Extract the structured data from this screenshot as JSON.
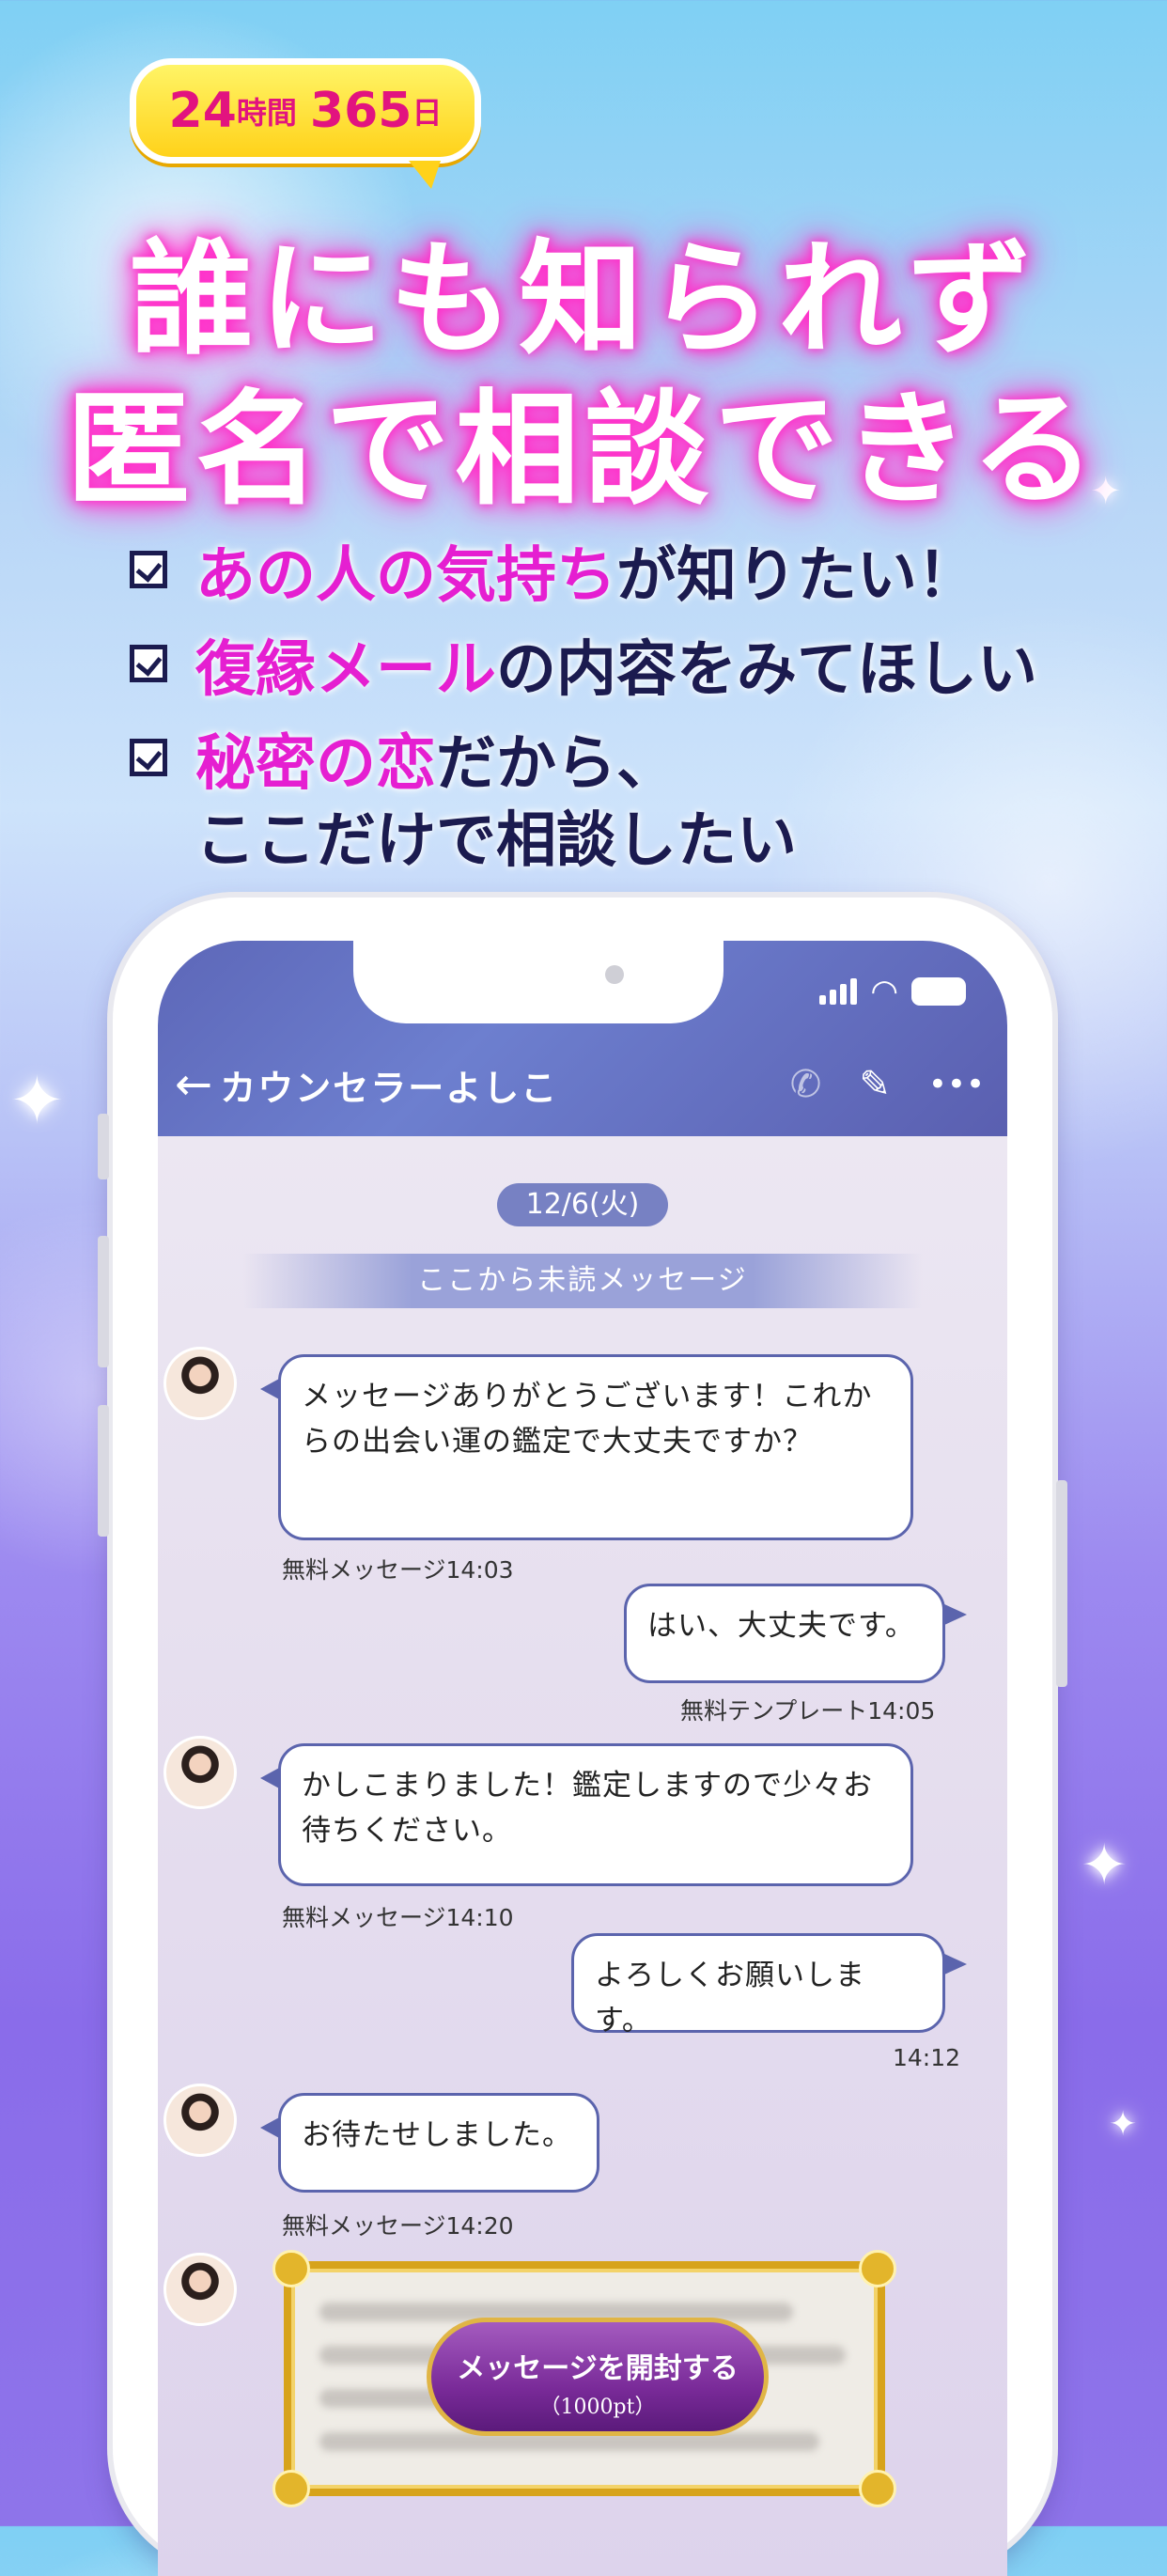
{
  "badge": {
    "hours": "24",
    "hours_unit": "時間",
    "days": "365",
    "days_unit": "日"
  },
  "headline": {
    "line1": "誰にも知られず",
    "line2": "匿名で相談できる"
  },
  "checklist": [
    {
      "highlight": "あの人の気持ち",
      "rest": "が知りたい！"
    },
    {
      "highlight": "復縁メール",
      "rest": "の内容をみてほしい"
    },
    {
      "highlight": "秘密の恋",
      "rest": "だから、",
      "line2": "ここだけで相談したい"
    }
  ],
  "chat": {
    "title": "カウンセラーよしこ",
    "date": "12/6(火)",
    "unread_label": "ここから未読メッセージ",
    "messages": [
      {
        "side": "left",
        "text": "メッセージありがとうございます！これからの出会い運の鑑定で大丈夫ですか？",
        "meta": "無料メッセージ14:03"
      },
      {
        "side": "right",
        "text": "はい、大丈夫です。",
        "meta": "無料テンプレート14:05"
      },
      {
        "side": "left",
        "text": "かしこまりました！鑑定しますので少々お待ちください。",
        "meta": "無料メッセージ14:10"
      },
      {
        "side": "right",
        "text": "よろしくお願いします。",
        "meta": "14:12"
      },
      {
        "side": "left",
        "text": "お待たせしました。",
        "meta": "無料メッセージ14:20"
      }
    ],
    "open_button": {
      "label": "メッセージを開封する",
      "price": "（1000pt）"
    }
  },
  "icons": {
    "back": "arrow-left-icon",
    "call": "phone-icon",
    "edit": "pencil-icon",
    "more": "more-icon"
  }
}
